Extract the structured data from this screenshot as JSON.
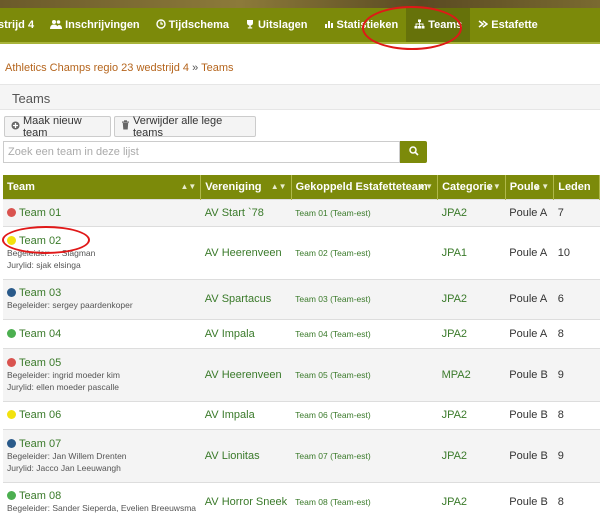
{
  "nav": {
    "items": [
      {
        "label": "strijd 4",
        "icon": ""
      },
      {
        "label": "Inschrijvingen",
        "icon": "users-icon"
      },
      {
        "label": "Tijdschema",
        "icon": "clock-icon"
      },
      {
        "label": "Uitslagen",
        "icon": "trophy-icon"
      },
      {
        "label": "Statistieken",
        "icon": "bar-chart-icon"
      },
      {
        "label": "Teams",
        "icon": "sitemap-icon",
        "active": true
      },
      {
        "label": "Estafette",
        "icon": "relay-icon"
      }
    ]
  },
  "breadcrumb": {
    "event": "Athletics Champs regio 23 wedstrijd 4",
    "separator": "»",
    "current": "Teams"
  },
  "panel": {
    "title": "Teams"
  },
  "actions": {
    "new_team": "Maak nieuw team",
    "delete_empty": "Verwijder alle lege teams"
  },
  "search": {
    "placeholder": "Zoek een team in deze lijst"
  },
  "table": {
    "headers": [
      "Team",
      "Vereniging",
      "Gekoppeld Estafetteteam",
      "Categorie",
      "Poule",
      "Leden"
    ],
    "rows": [
      {
        "name": "Team 01",
        "dot": "#d9534f",
        "meta": [],
        "vereniging": "AV Start `78",
        "estafette": "Team 01 (Team-est)",
        "categorie": "JPA2",
        "poule": "Poule A",
        "leden": "7"
      },
      {
        "name": "Team 02",
        "dot": "#f2e20e",
        "meta": [
          "Begeleider: ... Slagman",
          "Jurylid: sjak elsinga"
        ],
        "vereniging": "AV Heerenveen",
        "estafette": "Team 02 (Team-est)",
        "categorie": "JPA1",
        "poule": "Poule A",
        "leden": "10"
      },
      {
        "name": "Team 03",
        "dot": "#2a5a8a",
        "meta": [
          "Begeleider: sergey paardenkoper"
        ],
        "vereniging": "AV Spartacus",
        "estafette": "Team 03 (Team-est)",
        "categorie": "JPA2",
        "poule": "Poule A",
        "leden": "6"
      },
      {
        "name": "Team 04",
        "dot": "#4caf50",
        "meta": [],
        "vereniging": "AV Impala",
        "estafette": "Team 04 (Team-est)",
        "categorie": "JPA2",
        "poule": "Poule A",
        "leden": "8"
      },
      {
        "name": "Team 05",
        "dot": "#d9534f",
        "meta": [
          "Begeleider: ingrid moeder kim",
          "Jurylid: ellen moeder pascalle"
        ],
        "vereniging": "AV Heerenveen",
        "estafette": "Team 05 (Team-est)",
        "categorie": "MPA2",
        "poule": "Poule B",
        "leden": "9"
      },
      {
        "name": "Team 06",
        "dot": "#f2e20e",
        "meta": [],
        "vereniging": "AV Impala",
        "estafette": "Team 06 (Team-est)",
        "categorie": "JPA2",
        "poule": "Poule B",
        "leden": "8"
      },
      {
        "name": "Team 07",
        "dot": "#2a5a8a",
        "meta": [
          "Begeleider: Jan Willem Drenten",
          "Jurylid: Jacco Jan Leeuwangh"
        ],
        "vereniging": "AV Lionitas",
        "estafette": "Team 07 (Team-est)",
        "categorie": "JPA2",
        "poule": "Poule B",
        "leden": "9"
      },
      {
        "name": "Team 08",
        "dot": "#4caf50",
        "meta": [
          "Begeleider: Sander Sieperda, Evelien Breeuwsma"
        ],
        "vereniging": "AV Horror Sneek",
        "estafette": "Team 08 (Team-est)",
        "categorie": "JPA2",
        "poule": "Poule B",
        "leden": "8"
      }
    ]
  }
}
